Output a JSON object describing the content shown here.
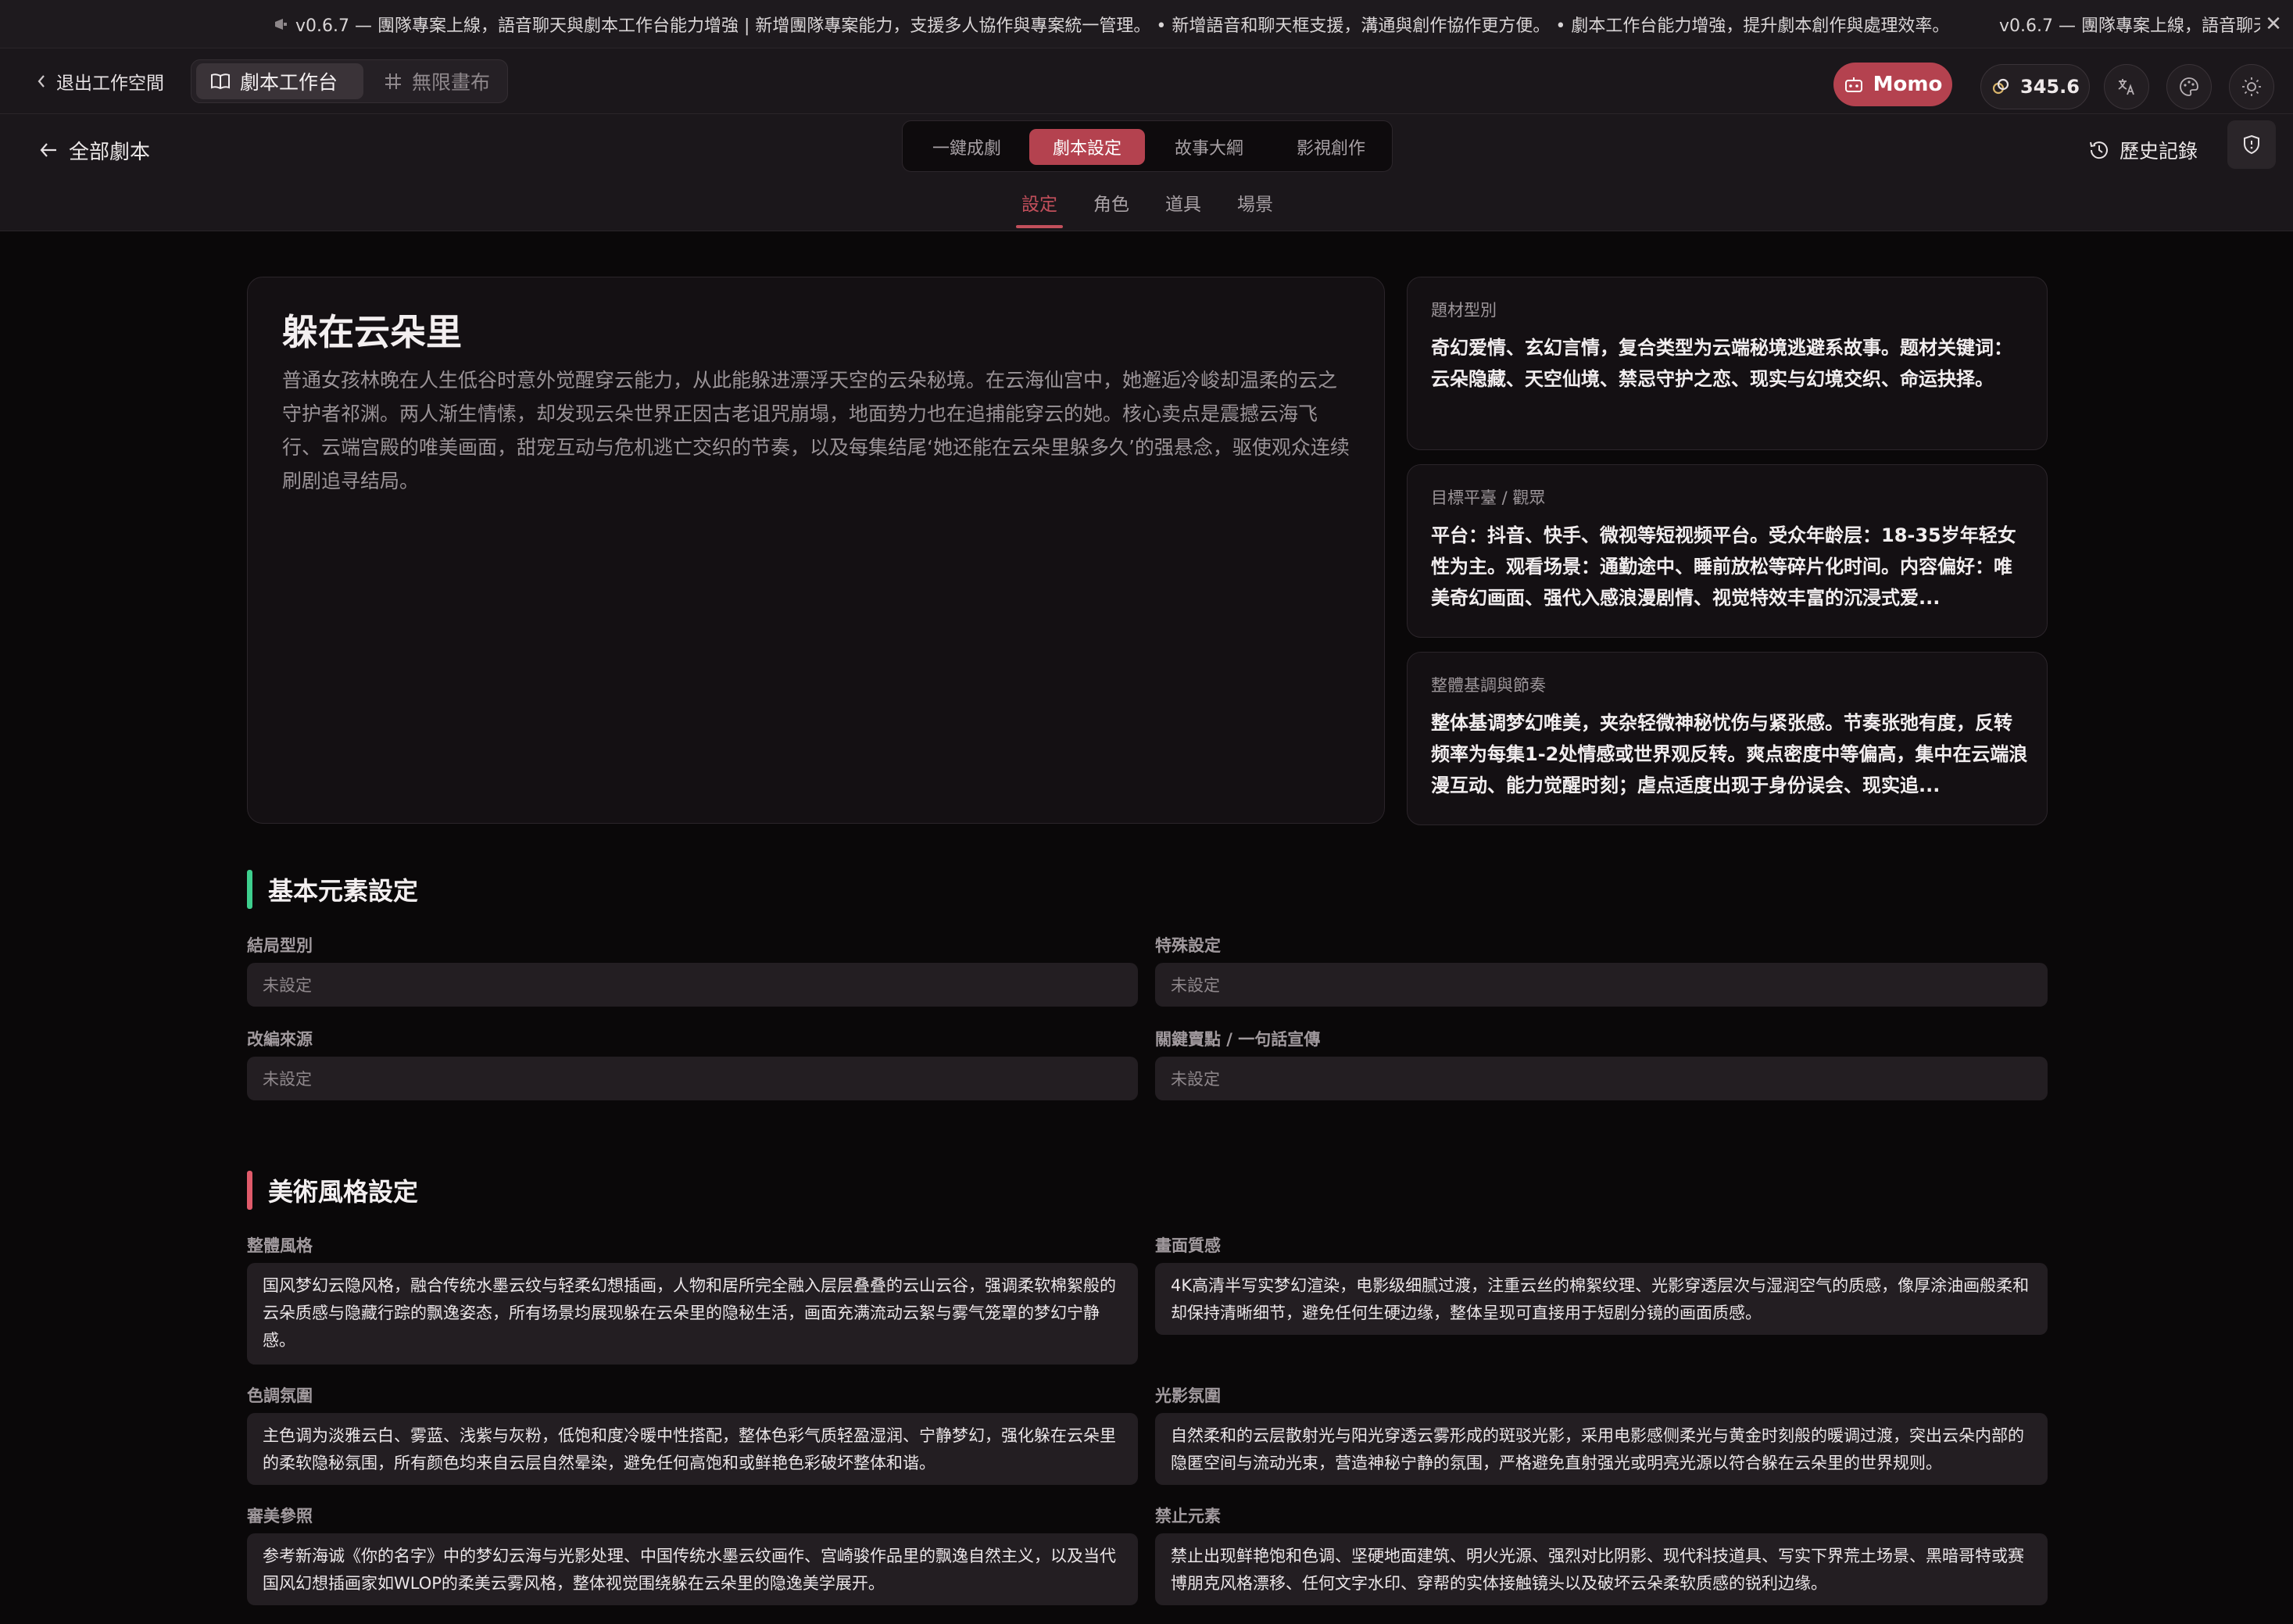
{
  "announcement": {
    "text": "v0.6.7 — 團隊專案上線，語音聊天與劇本工作台能力增強 | 新增團隊專案能力，支援多人協作與專案統一管理。 • 新增語音和聊天框支援，溝通與創作協作更方便。 • 劇本工作台能力增強，提升劇本創作與處理效率。",
    "repeat_text": "v0.6.7 — 團隊專案上線，語音聊天與劇本工作台能力增強"
  },
  "toolbar": {
    "exit_label": "退出工作空間",
    "tabs": [
      {
        "label": "劇本工作台",
        "icon": "book-icon"
      },
      {
        "label": "無限畫布",
        "icon": "grid-hash-icon"
      }
    ],
    "momo_label": "Momo",
    "credits": "345.6"
  },
  "nav": {
    "back_label": "全部劇本",
    "mode_tabs": [
      "一鍵成劇",
      "劇本設定",
      "故事大綱",
      "影視創作"
    ],
    "history_label": "歷史記錄",
    "sub_tabs": [
      "設定",
      "角色",
      "道具",
      "場景"
    ]
  },
  "story": {
    "title": "躲在云朵里",
    "summary": "普通女孩林晚在人生低谷时意外觉醒穿云能力，从此能躲进漂浮天空的云朵秘境。在云海仙宫中，她邂逅冷峻却温柔的云之守护者祁渊。两人渐生情愫，却发现云朵世界正因古老诅咒崩塌，地面势力也在追捕能穿云的她。核心卖点是震撼云海飞行、云端宫殿的唯美画面，甜宠互动与危机逃亡交织的节奏，以及每集结尾‘她还能在云朵里躲多久’的强悬念，驱使观众连续刷剧追寻结局。"
  },
  "side_cards": [
    {
      "label": "題材型別",
      "text": "奇幻爱情、玄幻言情，复合类型为云端秘境逃避系故事。题材关键词：云朵隐藏、天空仙境、禁忌守护之恋、现实与幻境交织、命运抉择。"
    },
    {
      "label": "目標平臺 / 觀眾",
      "text": "平台：抖音、快手、微视等短视频平台。受众年龄层：18-35岁年轻女性为主。观看场景：通勤途中、睡前放松等碎片化时间。内容偏好：唯美奇幻画面、强代入感浪漫剧情、视觉特效丰富的沉浸式爱..."
    },
    {
      "label": "整體基調與節奏",
      "text": "整体基调梦幻唯美，夹杂轻微神秘忧伤与紧张感。节奏张弛有度，反转频率为每集1-2处情感或世界观反转。爽点密度中等偏高，集中在云端浪漫互动、能力觉醒时刻；虐点适度出现于身份误会、现实追..."
    }
  ],
  "basic_section": {
    "title": "基本元素設定",
    "accent": "#3ecf8e",
    "fields": [
      {
        "label": "結局型別",
        "value": "未設定"
      },
      {
        "label": "特殊設定",
        "value": "未設定"
      },
      {
        "label": "改編來源",
        "value": "未設定"
      },
      {
        "label": "關鍵賣點 / 一句話宣傳",
        "value": "未設定"
      }
    ]
  },
  "art_section": {
    "title": "美術風格設定",
    "accent": "#e05a6a",
    "fields": [
      {
        "label": "整體風格",
        "value": "国风梦幻云隐风格，融合传统水墨云纹与轻柔幻想插画，人物和居所完全融入层层叠叠的云山云谷，强调柔软棉絮般的云朵质感与隐藏行踪的飘逸姿态，所有场景均展现躲在云朵里的隐秘生活，画面充满流动云絮与雾气笼罩的梦幻宁静感。"
      },
      {
        "label": "畫面質感",
        "value": "4K高清半写实梦幻渲染，电影级细腻过渡，注重云丝的棉絮纹理、光影穿透层次与湿润空气的质感，像厚涂油画般柔和却保持清晰细节，避免任何生硬边缘，整体呈现可直接用于短剧分镜的画面质感。"
      },
      {
        "label": "色調氛圍",
        "value": "主色调为淡雅云白、雾蓝、浅紫与灰粉，低饱和度冷暖中性搭配，整体色彩气质轻盈湿润、宁静梦幻，强化躲在云朵里的柔软隐秘氛围，所有颜色均来自云层自然晕染，避免任何高饱和或鲜艳色彩破坏整体和谐。"
      },
      {
        "label": "光影氛圍",
        "value": "自然柔和的云层散射光与阳光穿透云雾形成的斑驳光影，采用电影感侧柔光与黄金时刻般的暖调过渡，突出云朵内部的隐匿空间与流动光束，营造神秘宁静的氛围，严格避免直射强光或明亮光源以符合躲在云朵里的世界规则。"
      },
      {
        "label": "審美參照",
        "value": "参考新海诚《你的名字》中的梦幻云海与光影处理、中国传统水墨云纹画作、宫崎骏作品里的飘逸自然主义，以及当代国风幻想插画家如WLOP的柔美云雾风格，整体视觉围绕躲在云朵里的隐逸美学展开。"
      },
      {
        "label": "禁止元素",
        "value": "禁止出现鲜艳饱和色调、坚硬地面建筑、明火光源、强烈对比阴影、现代科技道具、写实下界荒土场景、黑暗哥特或赛博朋克风格漂移、任何文字水印、穿帮的实体接触镜头以及破坏云朵柔软质感的锐利边缘。"
      }
    ]
  }
}
